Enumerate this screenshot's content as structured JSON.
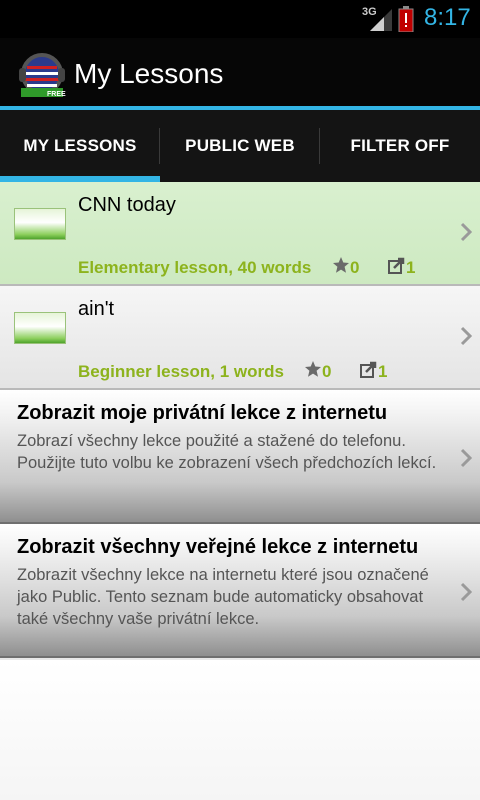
{
  "status_bar": {
    "network": "3G",
    "time": "8:17",
    "icons": [
      "signal-icon",
      "battery-alert-icon"
    ],
    "time_color": "#33b5e5"
  },
  "action_bar": {
    "title": "My Lessons",
    "logo_badge": "FREE",
    "accent": "#33b5e5"
  },
  "tabs": [
    {
      "label": "MY LESSONS",
      "selected": true
    },
    {
      "label": "PUBLIC WEB",
      "selected": false
    },
    {
      "label": "FILTER OFF",
      "selected": false
    }
  ],
  "lessons": [
    {
      "name": "CNN today",
      "meta": "Elementary lesson, 40 words",
      "stars": "0",
      "shares": "1",
      "selected": true
    },
    {
      "name": "ain't",
      "meta": "Beginner lesson, 1 words",
      "stars": "0",
      "shares": "1",
      "selected": false
    }
  ],
  "options": [
    {
      "title": "Zobrazit moje privátní lekce z internetu",
      "description": "Zobrazí všechny lekce použité a stažené do telefonu. Použijte tuto volbu ke zobrazení všech předchozích lekcí."
    },
    {
      "title": "Zobrazit všechny veřejné lekce z internetu",
      "description": "Zobrazit všechny lekce na internetu které jsou označené jako Public. Tento seznam bude automaticky obsahovat také všechny vaše privátní lekce."
    }
  ],
  "colors": {
    "meta_green": "#8db31d",
    "selected_row": "#d4edc8"
  }
}
